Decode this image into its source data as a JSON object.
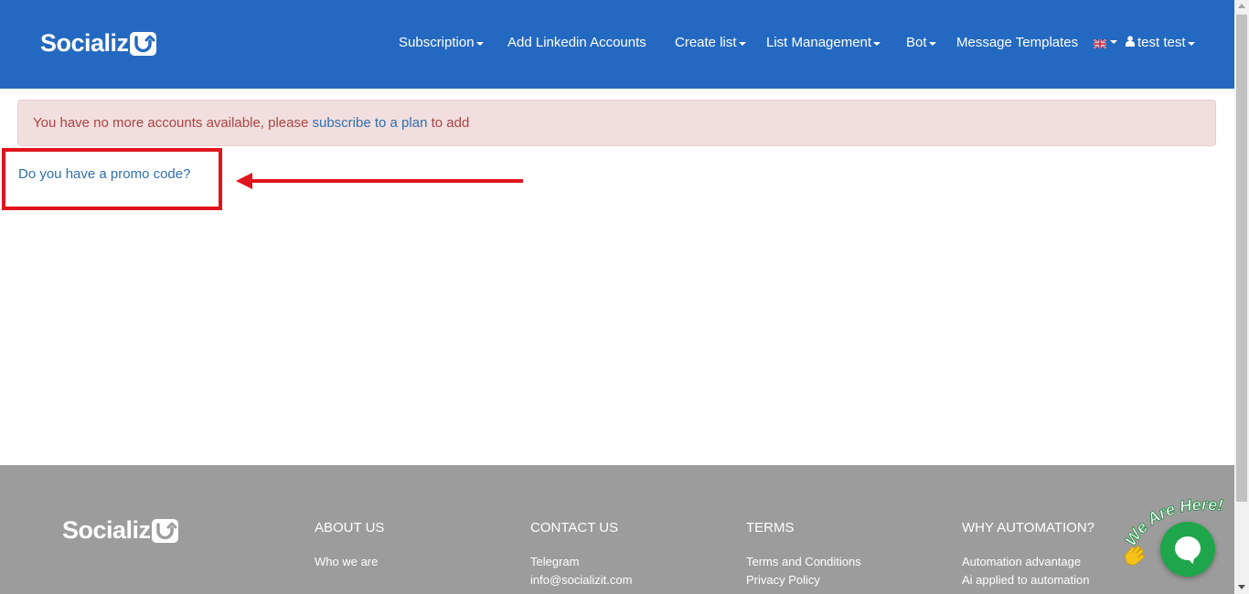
{
  "brand": {
    "name": "Socializ",
    "colors": {
      "primary": "#2469c1",
      "alert_bg": "#f2dede",
      "alert_text": "#a94442",
      "link": "#2f6fb0",
      "highlight": "#e0141c",
      "footer": "#9c9c9c",
      "chat": "#1fa64a"
    }
  },
  "nav": {
    "items": [
      {
        "label": "Subscription",
        "dropdown": true
      },
      {
        "label": "Add Linkedin Accounts",
        "dropdown": false
      },
      {
        "label": "Create list",
        "dropdown": true
      },
      {
        "label": "List Management",
        "dropdown": true
      },
      {
        "label": "Bot",
        "dropdown": true
      },
      {
        "label": "Message Templates",
        "dropdown": false
      }
    ],
    "language": {
      "icon": "uk-flag-icon",
      "dropdown": true
    },
    "user": {
      "icon": "user-icon",
      "label": "test test",
      "dropdown": true
    }
  },
  "alert": {
    "text_before": "You have no more accounts available, please ",
    "link": "subscribe to a plan",
    "text_after": " to add"
  },
  "promo": {
    "label": "Do you have a promo code?"
  },
  "footer": {
    "columns": [
      {
        "title": "ABOUT US",
        "links": [
          "Who we are"
        ]
      },
      {
        "title": "CONTACT US",
        "links": [
          "Telegram",
          "info@socializit.com"
        ]
      },
      {
        "title": "TERMS",
        "links": [
          "Terms and Conditions",
          "Privacy Policy"
        ]
      },
      {
        "title": "WHY AUTOMATION?",
        "links": [
          "Automation advantage",
          "Ai applied to automation"
        ]
      }
    ]
  },
  "chat": {
    "badge": "We Are Here!",
    "icons": [
      "chat-bubble-icon",
      "waving-hand-icon"
    ]
  }
}
